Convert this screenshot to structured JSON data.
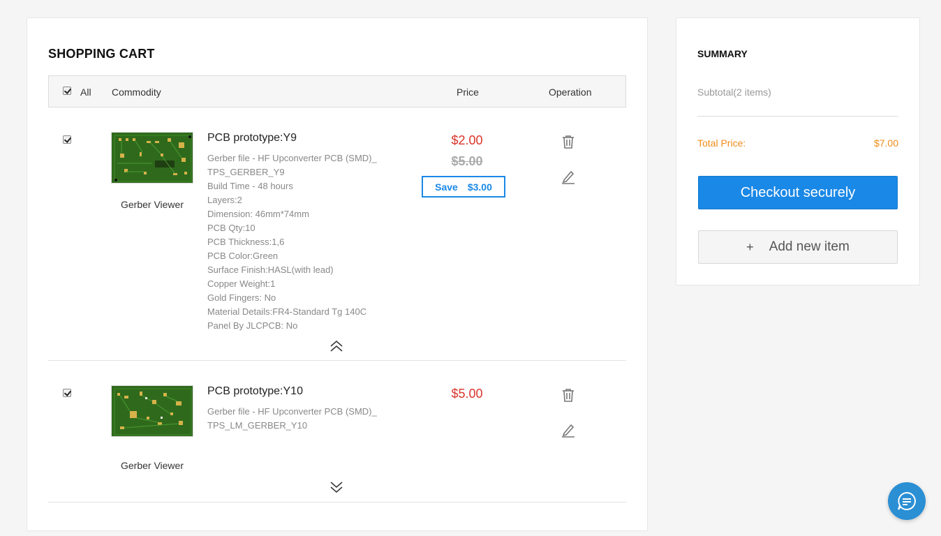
{
  "cart": {
    "title": "SHOPPING CART",
    "header": {
      "all_label": "All",
      "commodity_label": "Commodity",
      "price_label": "Price",
      "operation_label": "Operation"
    },
    "items": [
      {
        "checked": true,
        "name": "PCB prototype:Y9",
        "viewer_label": "Gerber Viewer",
        "specs": [
          "Gerber file - HF Upconverter PCB (SMD)_",
          "TPS_GERBER_Y9",
          "Build Time - 48 hours",
          "Layers:2",
          "Dimension: 46mm*74mm",
          "PCB Qty:10",
          "PCB Thickness:1,6",
          "PCB Color:Green",
          "Surface Finish:HASL(with lead)",
          "Copper Weight:1",
          "Gold Fingers: No",
          "Material Details:FR4-Standard Tg 140C",
          "Panel By JLCPCB: No"
        ],
        "price": "$2.00",
        "original_price": "$5.00",
        "save_label": "Save",
        "save_amount": "$3.00",
        "expanded": true
      },
      {
        "checked": true,
        "name": "PCB prototype:Y10",
        "viewer_label": "Gerber Viewer",
        "specs": [
          "Gerber file - HF Upconverter PCB (SMD)_",
          "TPS_LM_GERBER_Y10"
        ],
        "price": "$5.00",
        "expanded": false
      }
    ]
  },
  "summary": {
    "title": "SUMMARY",
    "subtotal": "Subtotal(2 items)",
    "total_label": "Total Price:",
    "total_value": "$7.00",
    "checkout_label": "Checkout securely",
    "add_item_symbol": "+",
    "add_item_label": "Add new item"
  },
  "icons": {
    "delete": "trash-icon",
    "edit": "pencil-icon",
    "collapse": "double-chevron-up-icon",
    "expand": "double-chevron-down-icon",
    "chat": "chat-icon"
  },
  "colors": {
    "accent": "#1a88e6",
    "price_red": "#d9342b",
    "total_orange": "#f08c19",
    "pcb_green": "#2b5a1a"
  }
}
